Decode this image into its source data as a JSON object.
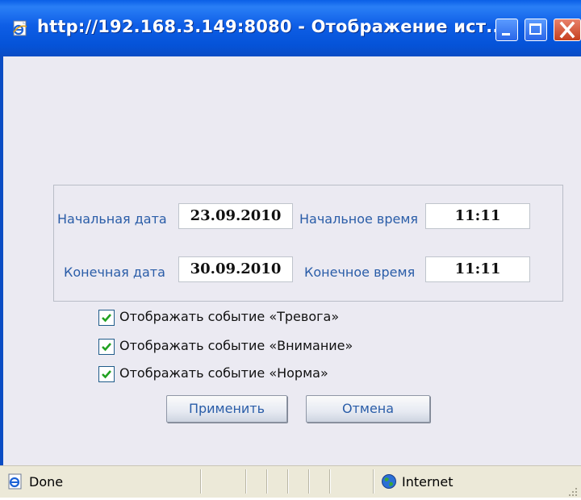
{
  "window": {
    "title": "http://192.168.3.149:8080 - Отображение ист..."
  },
  "form": {
    "start_date_label": "Начальная дата",
    "start_date_value": "23.09.2010",
    "start_time_label": "Начальное время",
    "start_time_value": "11:11",
    "end_date_label": "Конечная дата",
    "end_date_value": "30.09.2010",
    "end_time_label": "Конечное время",
    "end_time_value": "11:11"
  },
  "checkboxes": [
    {
      "label": "Отображать событие «Тревога»",
      "checked": true
    },
    {
      "label": "Отображать событие «Внимание»",
      "checked": true
    },
    {
      "label": "Отображать событие «Норма»",
      "checked": true
    }
  ],
  "buttons": {
    "apply": "Применить",
    "cancel": "Отмена"
  },
  "statusbar": {
    "status": "Done",
    "zone": "Internet"
  },
  "colors": {
    "titlebar": "#0553d8",
    "content_bg": "#ebeaf2",
    "label_blue": "#2a5da8"
  },
  "icons": [
    "ie-page-icon",
    "minimize-icon",
    "maximize-icon",
    "close-icon",
    "checkmark-icon",
    "globe-icon"
  ]
}
